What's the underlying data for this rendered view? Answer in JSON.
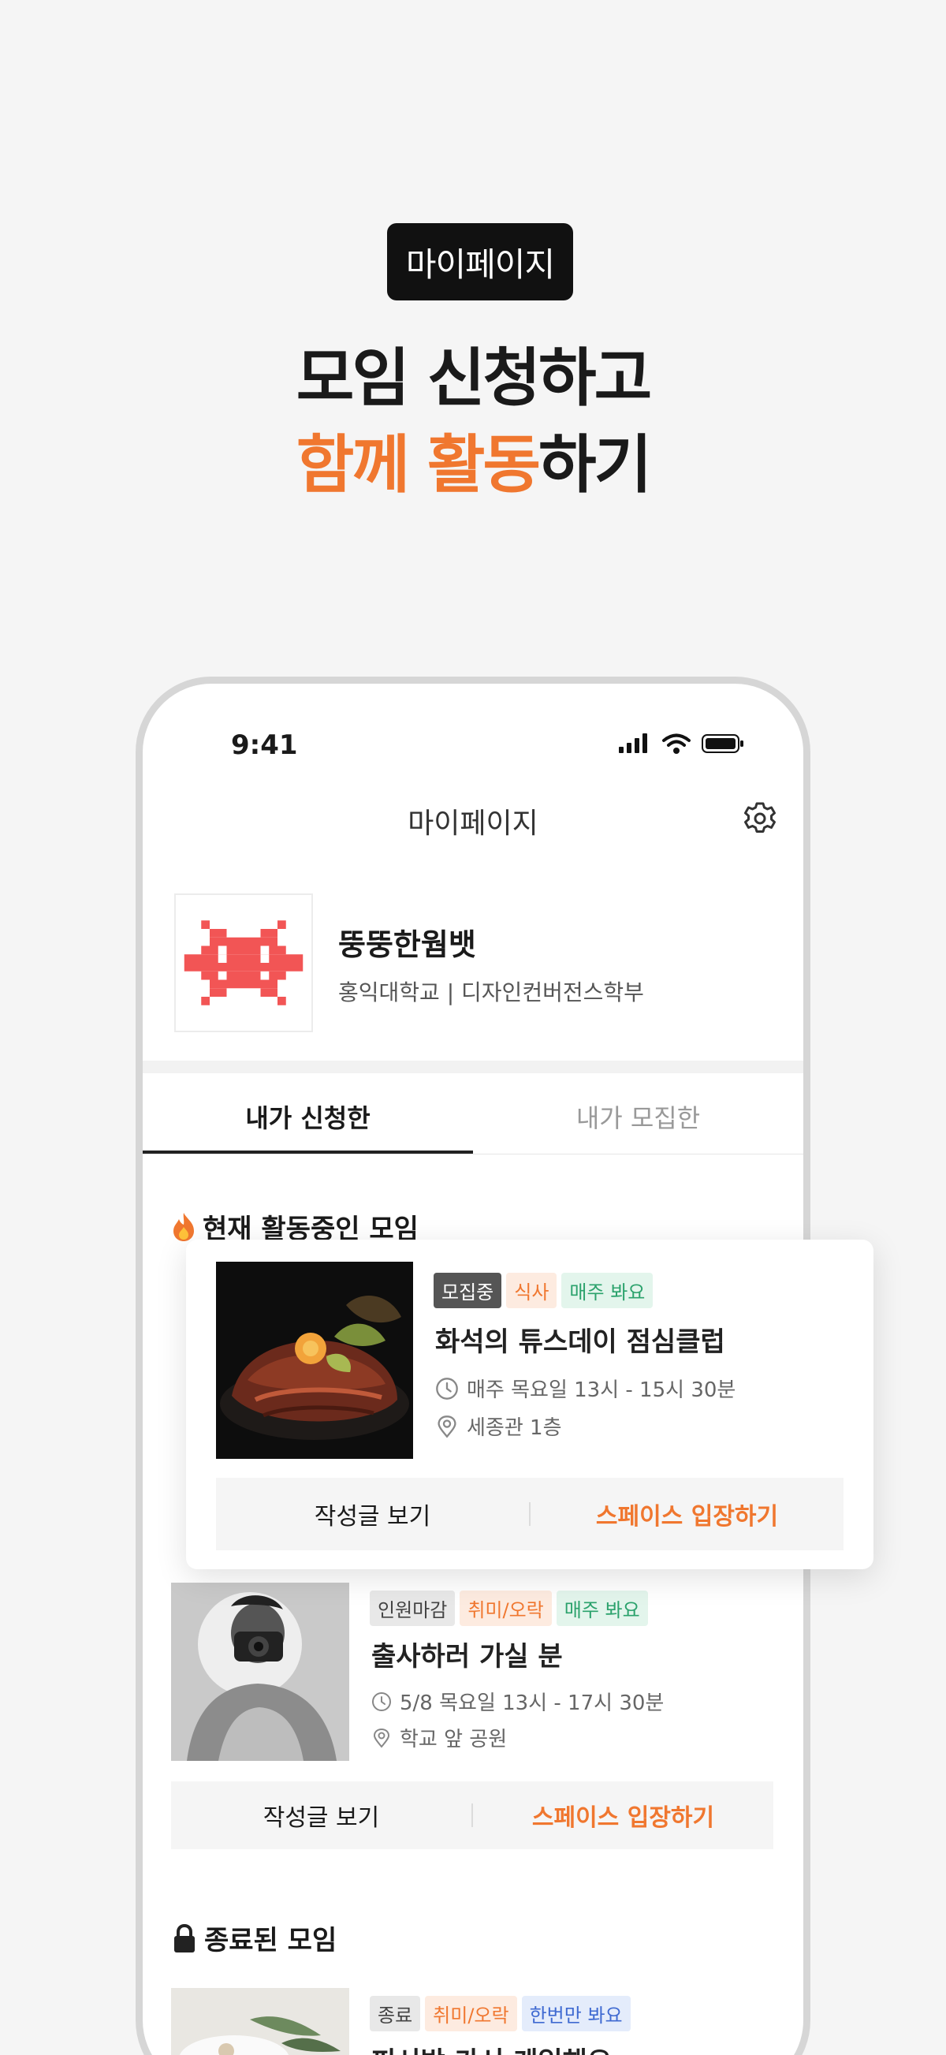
{
  "promo": {
    "badge": "마이페이지",
    "headline_line1": "모임 신청하고",
    "headline_accent": "함께 활동",
    "headline_rest": "하기"
  },
  "status_bar": {
    "time": "9:41"
  },
  "header": {
    "title": "마이페이지"
  },
  "profile": {
    "name": "뚱뚱한웜뱃",
    "school": "홍익대학교 | 디자인컨버전스학부"
  },
  "tabs": [
    {
      "label": "내가 신청한"
    },
    {
      "label": "내가 모집한"
    }
  ],
  "sections": {
    "active": "현재 활동중인 모임",
    "ended": "종료된 모임"
  },
  "cards": [
    {
      "tags": [
        "모집중",
        "식사",
        "매주 봐요"
      ],
      "name": "화석의 튜스데이 점심클럽",
      "time": "매주 목요일 13시 - 15시 30분",
      "place": "세종관 1층",
      "view_label": "작성글 보기",
      "enter_label": "스페이스 입장하기"
    },
    {
      "tags": [
        "인원마감",
        "취미/오락",
        "매주 봐요"
      ],
      "name": "출사하러 가실 분",
      "time": "5/8 목요일 13시 - 17시 30분",
      "place": "학교 앞 공원",
      "view_label": "작성글 보기",
      "enter_label": "스페이스 입장하기"
    },
    {
      "tags": [
        "종료",
        "취미/오락",
        "한번만 봐요"
      ],
      "name": "피시방 가서 게임해요"
    }
  ],
  "colors": {
    "accent": "#f0772f",
    "avatar": "#f25555"
  }
}
